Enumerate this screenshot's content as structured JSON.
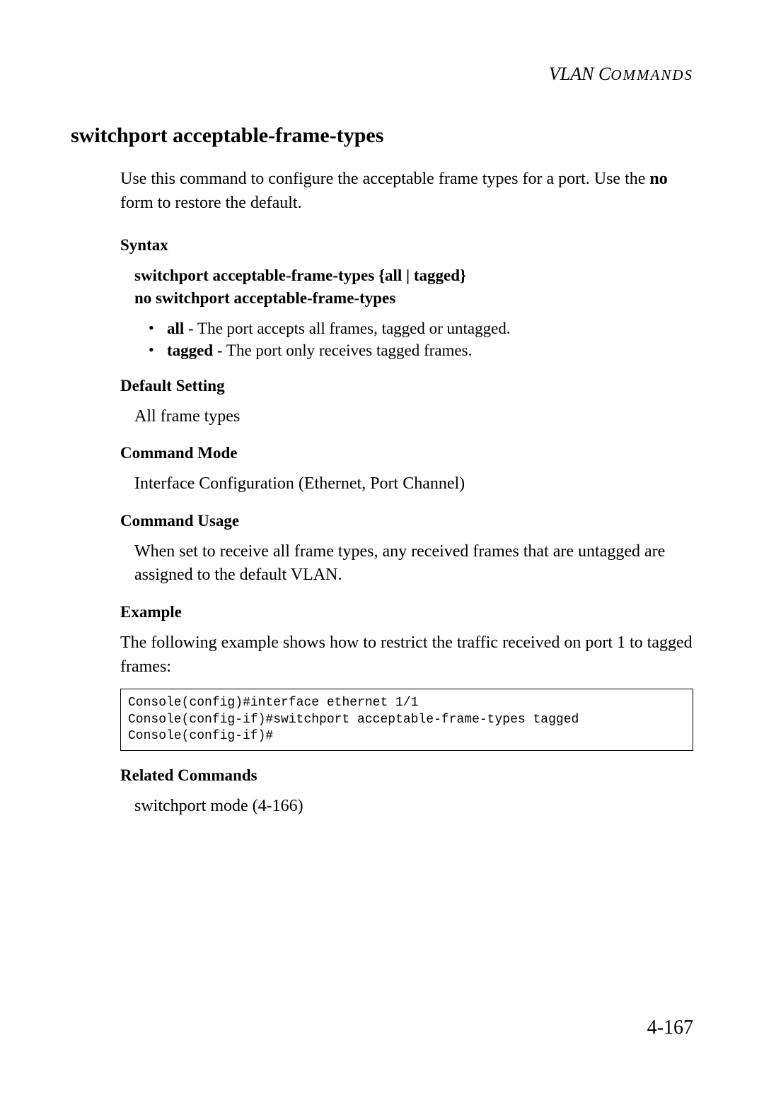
{
  "header": {
    "section_title_prefix": "VLAN C",
    "section_title_suffix": "OMMANDS"
  },
  "title": "switchport acceptable-frame-types",
  "intro": {
    "part1": "Use this command to configure the acceptable frame types for a port. Use the ",
    "bold": "no",
    "part2": " form to restore the default."
  },
  "syntax": {
    "heading": "Syntax",
    "line1_cmd": "switchport acceptable-frame-types",
    "line1_opts": " {",
    "line1_all": "all",
    "line1_pipe": " | ",
    "line1_tagged": "tagged",
    "line1_close": "}",
    "line2": "no switchport acceptable-frame-types",
    "bullets": [
      {
        "term": "all",
        "desc": " - The port accepts all frames, tagged or untagged."
      },
      {
        "term": "tagged",
        "desc": " - The port only receives tagged frames."
      }
    ]
  },
  "default_setting": {
    "heading": "Default Setting",
    "text": "All frame types"
  },
  "command_mode": {
    "heading": "Command Mode",
    "text": "Interface Configuration (Ethernet, Port Channel)"
  },
  "command_usage": {
    "heading": "Command Usage",
    "text": "When set to receive all frame types, any received frames that are untagged are assigned to the default VLAN."
  },
  "example": {
    "heading": "Example",
    "intro": "The following example shows how to restrict the traffic received on port 1 to tagged frames:",
    "code": "Console(config)#interface ethernet 1/1\nConsole(config-if)#switchport acceptable-frame-types tagged\nConsole(config-if)#"
  },
  "related": {
    "heading": "Related Commands",
    "text": "switchport mode (4-166)"
  },
  "page_number": "4-167"
}
